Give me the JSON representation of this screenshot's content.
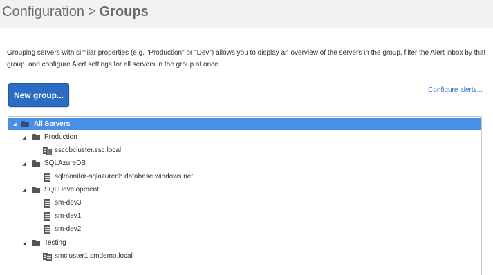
{
  "header": {
    "parent": "Configuration",
    "separator": ">",
    "current": "Groups"
  },
  "description": "Grouping servers with similar properties (e.g. \"Production\" or \"Dev\") allows you to display an overview of the servers in the group, filter the Alert inbox by that group, and configure Alert settings for all servers in the group at once.",
  "actions": {
    "new_group_label": "New group...",
    "configure_alerts_label": "Configure alerts..."
  },
  "tree": {
    "root": {
      "label": "All Servers",
      "toggle": "◢",
      "icon": "folder-icon"
    },
    "groups": [
      {
        "label": "Production",
        "toggle": "◢",
        "icon": "folder-icon",
        "servers": [
          {
            "label": "sscdbcluster.ssc.local",
            "icon": "cluster-icon"
          }
        ]
      },
      {
        "label": "SQLAzureDB",
        "toggle": "◢",
        "icon": "folder-icon",
        "servers": [
          {
            "label": "sqlmonitor-sqlazuredb.database.windows.net",
            "icon": "server-icon"
          }
        ]
      },
      {
        "label": "SQLDevelopment",
        "toggle": "◢",
        "icon": "folder-icon",
        "servers": [
          {
            "label": "sm-dev3",
            "icon": "server-icon"
          },
          {
            "label": "sm-dev1",
            "icon": "server-icon"
          },
          {
            "label": "sm-dev2",
            "icon": "server-icon"
          }
        ]
      },
      {
        "label": "Testing",
        "toggle": "◢",
        "icon": "folder-icon",
        "servers": [
          {
            "label": "smcluster1.smdemo.local",
            "icon": "cluster-icon"
          }
        ]
      }
    ]
  },
  "colors": {
    "accent": "#2b6cc4",
    "selection": "#4a8fe6",
    "header_bg": "#f2f2f2"
  }
}
